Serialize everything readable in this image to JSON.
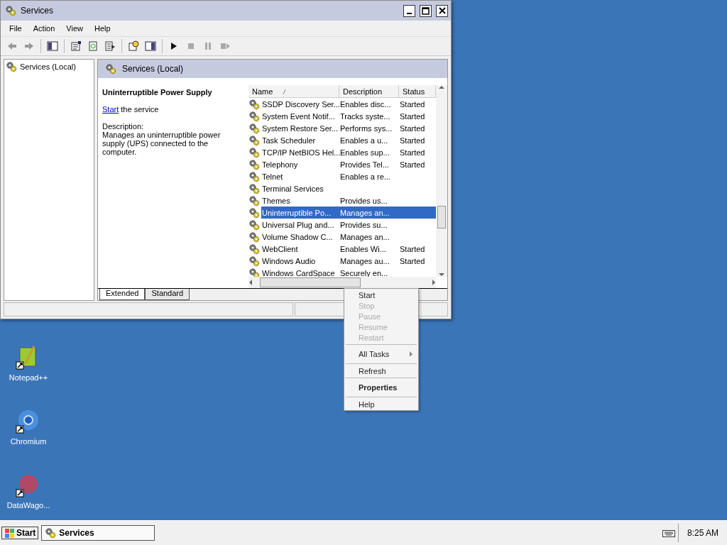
{
  "window": {
    "title": "Services",
    "menu": [
      "File",
      "Action",
      "View",
      "Help"
    ],
    "tree": [
      "Services (Local)"
    ],
    "pane_title": "Services (Local)",
    "detail": {
      "service": "Uninterruptible Power Supply",
      "action_link": "Start",
      "action_rest": "the service",
      "description_label": "Description:",
      "description": "Manages an uninterruptible power supply (UPS) connected to the computer."
    },
    "columns": [
      "Name",
      "Description",
      "Status"
    ],
    "rows": [
      {
        "name": "SSDP Discovery Ser...",
        "description": "Enables disc...",
        "status": "Started",
        "selected": false
      },
      {
        "name": "System Event Notif...",
        "description": "Tracks syste...",
        "status": "Started",
        "selected": false
      },
      {
        "name": "System Restore Ser...",
        "description": "Performs sys...",
        "status": "Started",
        "selected": false
      },
      {
        "name": "Task Scheduler",
        "description": "Enables a u...",
        "status": "Started",
        "selected": false
      },
      {
        "name": "TCP/IP NetBIOS Hel...",
        "description": "Enables sup...",
        "status": "Started",
        "selected": false
      },
      {
        "name": "Telephony",
        "description": "Provides Tel...",
        "status": "Started",
        "selected": false
      },
      {
        "name": "Telnet",
        "description": "Enables a re...",
        "selected": false
      },
      {
        "name": "Terminal Services",
        "selected": false
      },
      {
        "name": "Themes",
        "description": "Provides us...",
        "selected": false
      },
      {
        "name": "Uninterruptible Po...",
        "description": "Manages an...",
        "selected": true
      },
      {
        "name": "Universal Plug and...",
        "description": "Provides su...",
        "selected": false
      },
      {
        "name": "Volume Shadow C...",
        "description": "Manages an...",
        "selected": false
      },
      {
        "name": "WebClient",
        "description": "Enables Wi...",
        "status": "Started",
        "selected": false
      },
      {
        "name": "Windows Audio",
        "description": "Manages au...",
        "status": "Started",
        "selected": false
      },
      {
        "name": "Windows CardSpace",
        "description": "Securely en...",
        "selected": false
      }
    ],
    "tabs": [
      {
        "label": "Extended",
        "selected": true
      },
      {
        "label": "Standard",
        "selected": false
      }
    ]
  },
  "context_menu": [
    {
      "kind": "item",
      "label": "Start",
      "disabled": false,
      "default": false
    },
    {
      "kind": "item",
      "label": "Stop",
      "disabled": true,
      "default": false
    },
    {
      "kind": "item",
      "label": "Pause",
      "disabled": true,
      "default": false
    },
    {
      "kind": "item",
      "label": "Resume",
      "disabled": true,
      "default": false
    },
    {
      "kind": "item",
      "label": "Restart",
      "disabled": true,
      "default": false
    },
    {
      "kind": "separator"
    },
    {
      "kind": "submenu",
      "label": "All Tasks",
      "disabled": false,
      "default": false
    },
    {
      "kind": "separator"
    },
    {
      "kind": "item",
      "label": "Refresh",
      "disabled": false,
      "default": false
    },
    {
      "kind": "separator"
    },
    {
      "kind": "item",
      "label": "Properties",
      "disabled": false,
      "default": true
    },
    {
      "kind": "separator"
    },
    {
      "kind": "item",
      "label": "Help",
      "disabled": false,
      "default": false
    }
  ],
  "desktop_icons": [
    {
      "label": "Notepad++",
      "kind": "notepad"
    },
    {
      "label": "Chromium",
      "kind": "chromium"
    },
    {
      "label": "DataWago...",
      "kind": "datawagon"
    }
  ],
  "taskbar": {
    "start": "Start",
    "tasks": [
      {
        "label": "Services",
        "selected": true
      }
    ],
    "clock": "8:25 AM"
  }
}
